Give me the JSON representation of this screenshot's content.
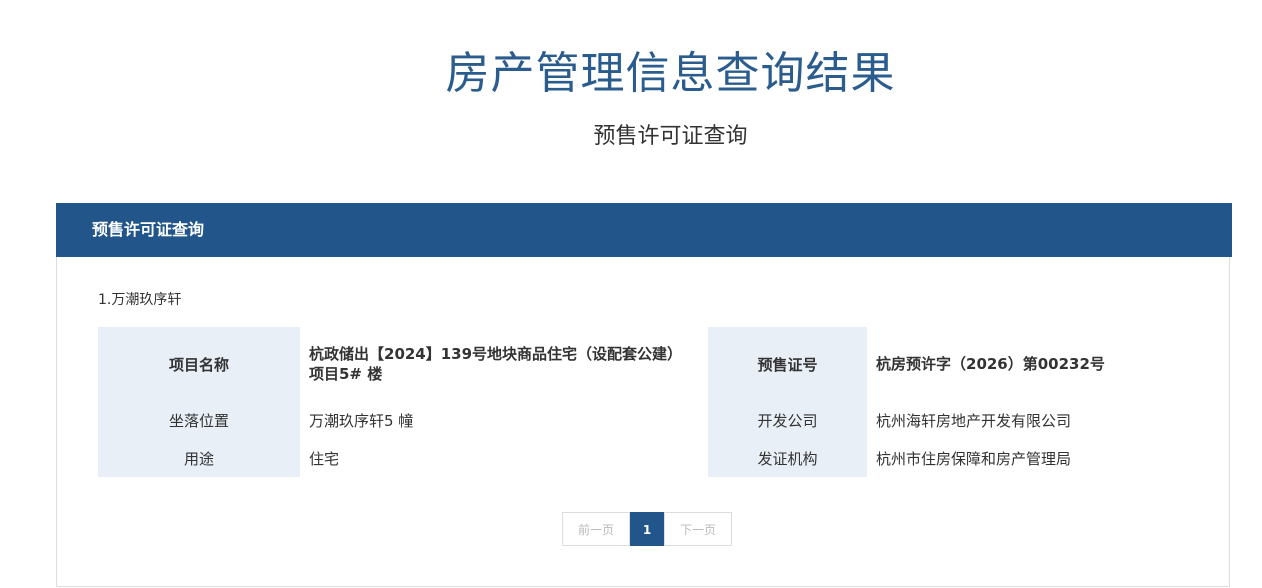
{
  "page": {
    "title": "房产管理信息查询结果",
    "subtitle": "预售许可证查询"
  },
  "panel": {
    "header": "预售许可证查询",
    "item_title": "1.万潮玖序轩",
    "fields": {
      "project_name_label": "项目名称",
      "project_name_value": "杭政储出【2024】139号地块商品住宅（设配套公建）项目5# 楼",
      "presale_no_label": "预售证号",
      "presale_no_value": "杭房预许字（2026）第00232号",
      "location_label": "坐落位置",
      "location_value": "万潮玖序轩5 幢",
      "developer_label": "开发公司",
      "developer_value": "杭州海轩房地产开发有限公司",
      "usage_label": "用途",
      "usage_value": "住宅",
      "issuer_label": "发证机构",
      "issuer_value": "杭州市住房保障和房产管理局"
    }
  },
  "pagination": {
    "prev": "前一页",
    "current": "1",
    "next": "下一页"
  },
  "colors": {
    "header_bg": "#22568b",
    "title": "#2b5c8e",
    "label_bg": "#e8eff7"
  }
}
